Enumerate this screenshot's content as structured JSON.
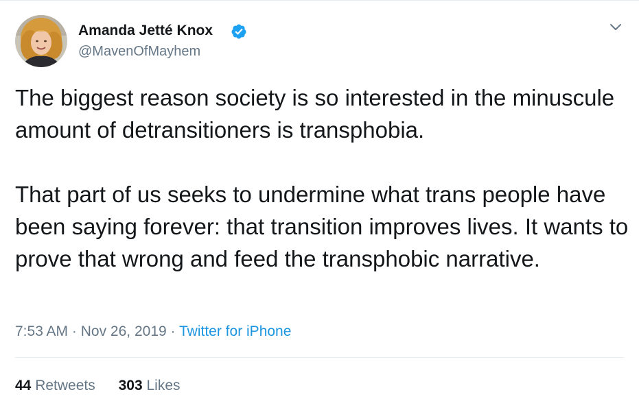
{
  "author": {
    "display_name": "Amanda Jetté Knox",
    "handle": "@MavenOfMayhem",
    "verified": true,
    "avatar_icon": "profile-photo"
  },
  "menu": {
    "icon": "chevron-down-icon"
  },
  "tweet": {
    "paragraphs": [
      "The biggest reason society is so interested in the minuscule amount of detransitioners is transphobia.",
      "That part of us seeks to undermine what trans people have been saying forever: that transition improves lives. It wants to prove that wrong and feed the transphobic narrative."
    ]
  },
  "meta": {
    "time": "7:53 AM",
    "sep1": "·",
    "date": "Nov 26, 2019",
    "sep2": "·",
    "source": "Twitter for iPhone"
  },
  "stats": {
    "retweets_count": "44",
    "retweets_label": "Retweets",
    "likes_count": "303",
    "likes_label": "Likes"
  },
  "colors": {
    "link": "#1b95e0",
    "verified": "#1da1f2",
    "secondary_text": "#657786",
    "primary_text": "#14171a",
    "divider": "#e6ecf0"
  }
}
